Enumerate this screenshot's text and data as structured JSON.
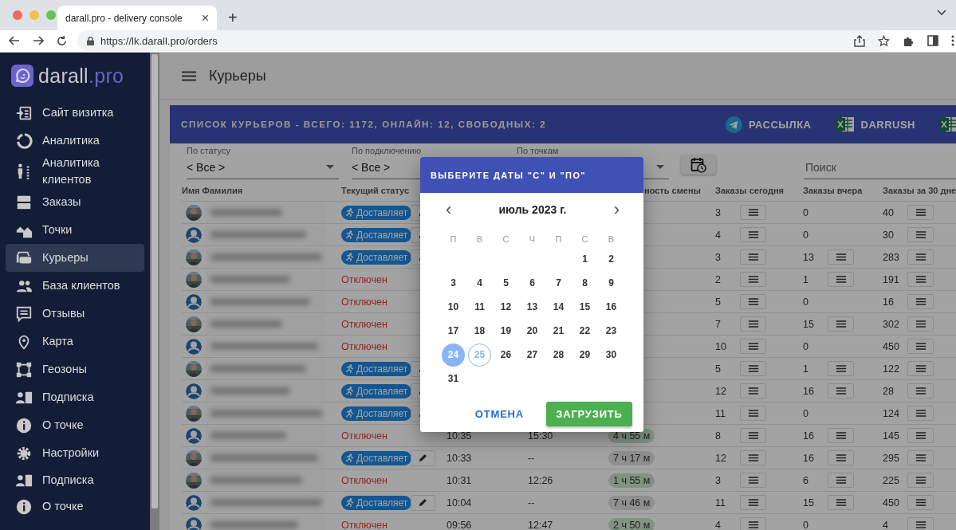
{
  "browser": {
    "tab_title": "darall.pro - delivery console",
    "tab_close": "×",
    "new_tab": "+",
    "url": "https://lk.darall.pro/orders"
  },
  "sidebar": {
    "logo": {
      "name": "darall",
      "suffix": ".pro"
    },
    "items": [
      {
        "label": "Сайт визитка",
        "selected": false
      },
      {
        "label": "Аналитика",
        "selected": false
      },
      {
        "label": "Аналитика клиентов",
        "selected": false
      },
      {
        "label": "Заказы",
        "selected": false
      },
      {
        "label": "Точки",
        "selected": false
      },
      {
        "label": "Курьеры",
        "selected": true
      },
      {
        "label": "База клиентов",
        "selected": false
      },
      {
        "label": "Отзывы",
        "selected": false
      },
      {
        "label": "Карта",
        "selected": false
      },
      {
        "label": "Геозоны",
        "selected": false
      },
      {
        "label": "Подписка",
        "selected": false
      },
      {
        "label": "О точке",
        "selected": false
      },
      {
        "label": "Настройки",
        "selected": false
      }
    ],
    "bottom_items": [
      {
        "label": "Подписка",
        "selected": false
      },
      {
        "label": "О точке",
        "selected": false
      }
    ]
  },
  "page_title": "Курьеры",
  "card": {
    "title": "СПИСОК КУРЬЕРОВ - ВСЕГО: 1172, ОНЛАЙН: 12, СВОБОДНЫХ: 2",
    "actions": [
      {
        "kind": "telegram",
        "label": "РАССЫЛКА"
      },
      {
        "kind": "excel",
        "label": "DARRUSH"
      },
      {
        "kind": "excel"
      }
    ]
  },
  "filters": [
    {
      "label": "По статусу",
      "value": "< Все >"
    },
    {
      "label": "По подключению",
      "value": "< Все >"
    },
    {
      "label": "По точкам"
    }
  ],
  "search": {
    "placeholder": "Поиск"
  },
  "table": {
    "columns": [
      "Имя Фамилия",
      "Текущий статус",
      "ность смены",
      "Заказы сегодня",
      "Заказы вчера",
      "Заказы за 30 дне"
    ],
    "rows": [
      {
        "status": {
          "kind": "delivering",
          "text": "Доставляет"
        },
        "editable": true,
        "today": {
          "value": "3",
          "details": true
        },
        "yesterday": {
          "value": "0",
          "details": false
        },
        "month": {
          "value": "40",
          "details": true
        }
      },
      {
        "avatar": {
          "kind": "default"
        },
        "status": {
          "kind": "delivering",
          "text": "Доставляет"
        },
        "editable": true,
        "today": {
          "value": "4",
          "details": true
        },
        "yesterday": {
          "value": "0",
          "details": false
        },
        "month": {
          "value": "30",
          "details": true
        }
      },
      {
        "status": {
          "kind": "delivering",
          "text": "Доставляет"
        },
        "editable": true,
        "today": {
          "value": "3",
          "details": true
        },
        "yesterday": {
          "value": "13",
          "details": true
        },
        "month": {
          "value": "283",
          "details": true
        }
      },
      {
        "status": {
          "kind": "offline",
          "text": "Отключен"
        },
        "editable": false,
        "today": {
          "value": "2",
          "details": true
        },
        "yesterday": {
          "value": "1",
          "details": true
        },
        "month": {
          "value": "191",
          "details": true
        }
      },
      {
        "avatar": {
          "kind": "default"
        },
        "status": {
          "kind": "offline",
          "text": "Отключен"
        },
        "editable": false,
        "today": {
          "value": "5",
          "details": true
        },
        "yesterday": {
          "value": "0",
          "details": false
        },
        "month": {
          "value": "16",
          "details": true
        }
      },
      {
        "status": {
          "kind": "offline",
          "text": "Отключен"
        },
        "editable": false,
        "today": {
          "value": "7",
          "details": true
        },
        "yesterday": {
          "value": "15",
          "details": true
        },
        "month": {
          "value": "302",
          "details": true
        }
      },
      {
        "avatar": {
          "kind": "default"
        },
        "status": {
          "kind": "offline",
          "text": "Отключен"
        },
        "editable": false,
        "today": {
          "value": "10",
          "details": true
        },
        "yesterday": {
          "value": "0",
          "details": false
        },
        "month": {
          "value": "450",
          "details": true
        }
      },
      {
        "status": {
          "kind": "delivering",
          "text": "Доставляет"
        },
        "editable": true,
        "today": {
          "value": "5",
          "details": true
        },
        "yesterday": {
          "value": "1",
          "details": true
        },
        "month": {
          "value": "122",
          "details": true
        }
      },
      {
        "avatar": {
          "kind": "default"
        },
        "status": {
          "kind": "delivering",
          "text": "Доставляет"
        },
        "editable": true,
        "today": {
          "value": "12",
          "details": true
        },
        "yesterday": {
          "value": "16",
          "details": true
        },
        "month": {
          "value": "28",
          "details": true
        }
      },
      {
        "status": {
          "kind": "delivering",
          "text": "Доставляет"
        },
        "editable": true,
        "today": {
          "value": "11",
          "details": true
        },
        "yesterday": {
          "value": "0",
          "details": false
        },
        "month": {
          "value": "124",
          "details": true
        }
      },
      {
        "avatar": {
          "kind": "default"
        },
        "status": {
          "kind": "offline",
          "text": "Отключен"
        },
        "editable": false,
        "start": "10:35",
        "end": "15:30",
        "duration": {
          "text": "4 ч 55 м",
          "finished": true
        },
        "today": {
          "value": "8",
          "details": true
        },
        "yesterday": {
          "value": "16",
          "details": true
        },
        "month": {
          "value": "145",
          "details": true
        }
      },
      {
        "status": {
          "kind": "delivering",
          "text": "Доставляет"
        },
        "editable": true,
        "start": "10:33",
        "end": "--",
        "duration": {
          "text": "7 ч 17 м",
          "finished": false
        },
        "today": {
          "value": "12",
          "details": true
        },
        "yesterday": {
          "value": "16",
          "details": true
        },
        "month": {
          "value": "295",
          "details": true
        }
      },
      {
        "status": {
          "kind": "offline",
          "text": "Отключен"
        },
        "editable": false,
        "start": "10:31",
        "end": "12:26",
        "duration": {
          "text": "1 ч 55 м",
          "finished": true
        },
        "today": {
          "value": "3",
          "details": true
        },
        "yesterday": {
          "value": "6",
          "details": true
        },
        "month": {
          "value": "225",
          "details": true
        }
      },
      {
        "avatar": {
          "kind": "default"
        },
        "status": {
          "kind": "delivering",
          "text": "Доставляет"
        },
        "editable": true,
        "start": "10:04",
        "end": "--",
        "duration": {
          "text": "7 ч 46 м",
          "finished": false
        },
        "today": {
          "value": "11",
          "details": true
        },
        "yesterday": {
          "value": "15",
          "details": true
        },
        "month": {
          "value": "450",
          "details": true
        }
      },
      {
        "avatar": {
          "kind": "default"
        },
        "status": {
          "kind": "offline",
          "text": "Отключен"
        },
        "editable": false,
        "start": "09:56",
        "end": "12:47",
        "duration": {
          "text": "2 ч 50 м",
          "finished": true
        },
        "today": {
          "value": "4",
          "details": true
        },
        "yesterday": {
          "value": "0",
          "details": false
        },
        "month": {
          "value": "4",
          "details": true
        }
      }
    ]
  },
  "dialog": {
    "title": "ВЫБЕРИТЕ ДАТЫ \"С\" И \"ПО\"",
    "month": "июль 2023 г.",
    "prev": "‹",
    "next": "›",
    "weekdays": [
      "П",
      "В",
      "С",
      "Ч",
      "П",
      "С",
      "В"
    ],
    "weeks": [
      {
        "kind": "trailing",
        "days": [
          {
            "label": "1",
            "selected": false,
            "today": false
          },
          {
            "label": "2",
            "selected": false,
            "today": false
          }
        ]
      },
      {
        "kind": "full",
        "days": [
          {
            "label": "3",
            "selected": false,
            "today": false
          },
          {
            "label": "4",
            "selected": false,
            "today": false
          },
          {
            "label": "5",
            "selected": false,
            "today": false
          },
          {
            "label": "6",
            "selected": false,
            "today": false
          },
          {
            "label": "7",
            "selected": false,
            "today": false
          },
          {
            "label": "8",
            "selected": false,
            "today": false
          },
          {
            "label": "9",
            "selected": false,
            "today": false
          }
        ]
      },
      {
        "kind": "full",
        "days": [
          {
            "label": "10",
            "selected": false,
            "today": false
          },
          {
            "label": "11",
            "selected": false,
            "today": false
          },
          {
            "label": "12",
            "selected": false,
            "today": false
          },
          {
            "label": "13",
            "selected": false,
            "today": false
          },
          {
            "label": "14",
            "selected": false,
            "today": false
          },
          {
            "label": "15",
            "selected": false,
            "today": false
          },
          {
            "label": "16",
            "selected": false,
            "today": false
          }
        ]
      },
      {
        "kind": "full",
        "days": [
          {
            "label": "17",
            "selected": false,
            "today": false
          },
          {
            "label": "18",
            "selected": false,
            "today": false
          },
          {
            "label": "19",
            "selected": false,
            "today": false
          },
          {
            "label": "20",
            "selected": false,
            "today": false
          },
          {
            "label": "21",
            "selected": false,
            "today": false
          },
          {
            "label": "22",
            "selected": false,
            "today": false
          },
          {
            "label": "23",
            "selected": false,
            "today": false
          }
        ]
      },
      {
        "kind": "full",
        "days": [
          {
            "label": "24",
            "selected": true,
            "today": false
          },
          {
            "label": "25",
            "selected": false,
            "today": true
          },
          {
            "label": "26",
            "selected": false,
            "today": false
          },
          {
            "label": "27",
            "selected": false,
            "today": false
          },
          {
            "label": "28",
            "selected": false,
            "today": false
          },
          {
            "label": "29",
            "selected": false,
            "today": false
          },
          {
            "label": "30",
            "selected": false,
            "today": false
          }
        ]
      },
      {
        "kind": "leading",
        "days": [
          {
            "label": "31",
            "selected": false,
            "today": false
          }
        ]
      }
    ],
    "cancel": "ОТМЕНА",
    "confirm": "ЗАГРУЗИТЬ"
  }
}
